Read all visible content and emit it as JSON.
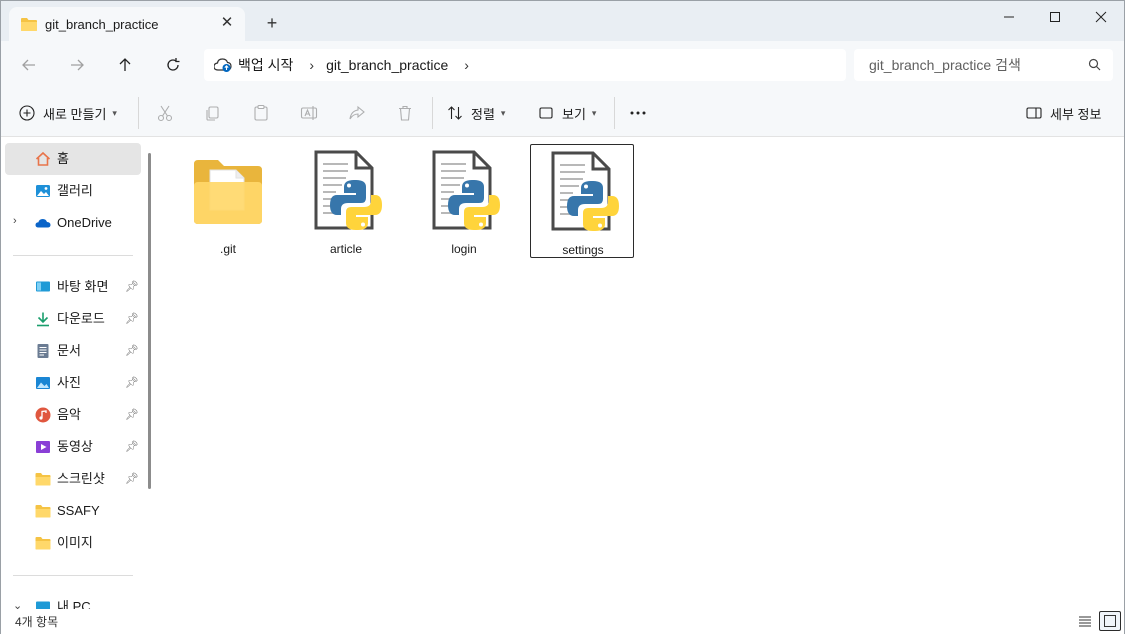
{
  "window": {
    "tab_title": "git_branch_practice",
    "tab_icon": "folder-icon"
  },
  "address": {
    "root": "백업 시작",
    "current": "git_branch_practice"
  },
  "search": {
    "placeholder": "git_branch_practice 검색"
  },
  "toolbar": {
    "new_label": "새로 만들기",
    "sort_label": "정렬",
    "view_label": "보기",
    "details_label": "세부 정보"
  },
  "sidebar": {
    "items": [
      {
        "label": "홈",
        "icon": "home-icon"
      },
      {
        "label": "갤러리",
        "icon": "gallery-icon"
      },
      {
        "label": "OneDrive",
        "icon": "cloud-icon"
      },
      {
        "label": "바탕 화면",
        "icon": "desktop-icon"
      },
      {
        "label": "다운로드",
        "icon": "download-icon"
      },
      {
        "label": "문서",
        "icon": "document-icon"
      },
      {
        "label": "사진",
        "icon": "pictures-icon"
      },
      {
        "label": "음악",
        "icon": "music-icon"
      },
      {
        "label": "동영상",
        "icon": "video-icon"
      },
      {
        "label": "스크린샷",
        "icon": "folder-icon"
      },
      {
        "label": "SSAFY",
        "icon": "folder-icon"
      },
      {
        "label": "이미지",
        "icon": "folder-icon"
      },
      {
        "label": "내 PC",
        "icon": "pc-icon"
      }
    ]
  },
  "files": [
    {
      "name": ".git",
      "type": "folder"
    },
    {
      "name": "article",
      "type": "python"
    },
    {
      "name": "login",
      "type": "python"
    },
    {
      "name": "settings",
      "type": "python"
    }
  ],
  "status": {
    "count": "4개 항목"
  },
  "colors": {
    "folder": "#f5c344",
    "python_blue": "#3776ab",
    "python_yellow": "#ffd43b",
    "accent": "#0067c0"
  }
}
